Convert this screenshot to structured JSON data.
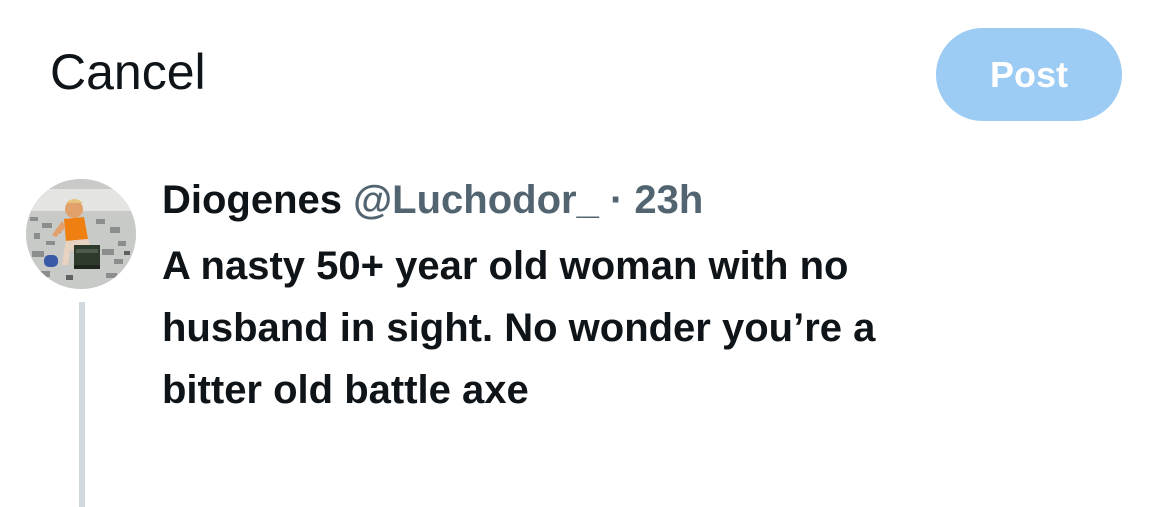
{
  "topbar": {
    "cancel_label": "Cancel",
    "post_label": "Post"
  },
  "tweet": {
    "author_name": "Diogenes",
    "handle": "@Luchodor_",
    "separator": "·",
    "time": "23h",
    "text_lines": [
      "A nasty 50+ year old woman with no",
      "husband in sight. No wonder you’re a",
      "bitter old battle axe"
    ]
  },
  "colors": {
    "post_button_disabled": "#9ccbf4",
    "secondary_text": "#536471",
    "thread_line": "#cfd9de"
  }
}
